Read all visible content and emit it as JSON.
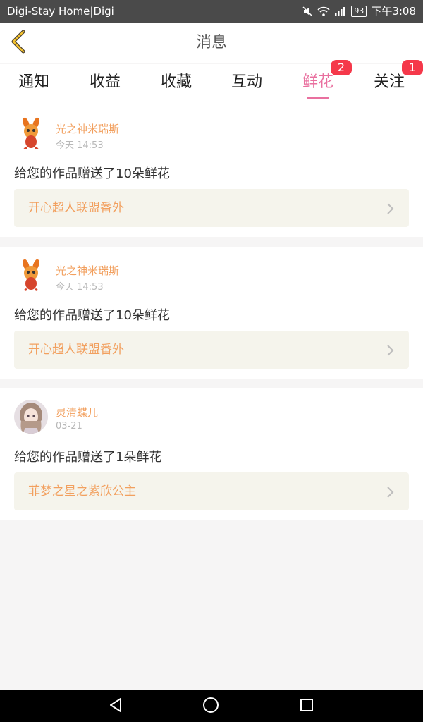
{
  "status_bar": {
    "carrier": "Digi-Stay Home|Digi",
    "battery": "93",
    "time": "下午3:08"
  },
  "header": {
    "title": "消息",
    "back_icon": "chevron-left-icon"
  },
  "tabs": [
    {
      "label": "通知",
      "active": false,
      "badge": ""
    },
    {
      "label": "收益",
      "active": false,
      "badge": ""
    },
    {
      "label": "收藏",
      "active": false,
      "badge": ""
    },
    {
      "label": "互动",
      "active": false,
      "badge": ""
    },
    {
      "label": "鲜花",
      "active": true,
      "badge": "2"
    },
    {
      "label": "关注",
      "active": false,
      "badge": "1"
    }
  ],
  "messages": [
    {
      "username": "光之神米瑞斯",
      "time": "今天 14:53",
      "text": "给您的作品赠送了10朵鲜花",
      "work": "开心超人联盟番外"
    },
    {
      "username": "光之神米瑞斯",
      "time": "今天 14:53",
      "text": "给您的作品赠送了10朵鲜花",
      "work": "开心超人联盟番外"
    },
    {
      "username": "灵清蝶儿",
      "time": "03-21",
      "text": "给您的作品赠送了1朵鲜花",
      "work": "菲梦之星之紫欣公主"
    }
  ],
  "colors": {
    "accent": "#e9709f",
    "username": "#f2a05f",
    "badge": "#f5384a"
  }
}
